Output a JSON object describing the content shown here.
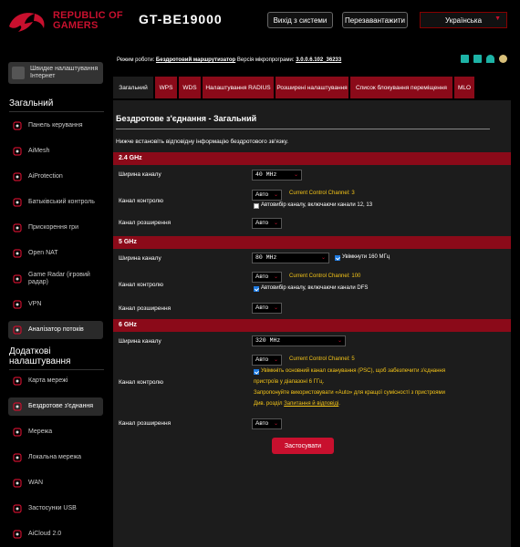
{
  "header": {
    "brand_line1": "REPUBLIC OF",
    "brand_line2": "GAMERS",
    "model": "GT-BE19000",
    "logout_label": "Вихід з системи",
    "reboot_label": "Перезавантажити",
    "language": "Українська"
  },
  "sidebar": {
    "quick_setup": "Швидке налаштування Інтернет",
    "general_title": "Загальний",
    "general_items": [
      {
        "label": "Панель керування",
        "icon": "dashboard-icon"
      },
      {
        "label": "AiMesh",
        "icon": "aimesh-icon"
      },
      {
        "label": "AiProtection",
        "icon": "aiprotection-icon"
      },
      {
        "label": "Батьківський контроль",
        "icon": "parental-control-icon"
      },
      {
        "label": "Прискорення гри",
        "icon": "game-boost-icon"
      },
      {
        "label": "Open NAT",
        "icon": "open-nat-icon"
      },
      {
        "label": "Game Radar (ігровий радар)",
        "icon": "game-radar-icon"
      },
      {
        "label": "VPN",
        "icon": "vpn-icon"
      },
      {
        "label": "Аналізатор потоків",
        "icon": "traffic-analyzer-icon"
      }
    ],
    "advanced_title": "Додаткові налаштування",
    "advanced_items": [
      {
        "label": "Карта мережі",
        "icon": "network-map-icon"
      },
      {
        "label": "Бездротове з'єднання",
        "icon": "wireless-icon"
      },
      {
        "label": "Мережа",
        "icon": "network-icon"
      },
      {
        "label": "Локальна мережа",
        "icon": "lan-icon"
      },
      {
        "label": "WAN",
        "icon": "wan-icon"
      },
      {
        "label": "Застосунки USB",
        "icon": "usb-icon"
      },
      {
        "label": "AiCloud 2.0",
        "icon": "aicloud-icon"
      }
    ]
  },
  "status": {
    "mode_label": "Режим роботи:",
    "mode_value": "Бездротовий маршрутизатор",
    "fw_label": "Версія мікропрограми:",
    "fw_value": "3.0.0.6.102_36233"
  },
  "tabs": [
    "Загальний",
    "WPS",
    "WDS",
    "Налаштування RADIUS",
    "Розширені налаштування",
    "Список блокування переміщення",
    "MLO"
  ],
  "page": {
    "title": "Бездротове з'єднання - Загальний",
    "description": "Нижче встановіть відповідну інформацію бездротового зв'язку."
  },
  "bands": {
    "b24": {
      "title": "2.4 GHz",
      "width_label": "Ширина каналу",
      "width_value": "40 MHz",
      "control_label": "Канал контролю",
      "control_value": "Авто",
      "current_channel": "Current Control Channel: 3",
      "auto_label": "Автовибір каналу, включаючи канали 12, 13",
      "ext_label": "Канал розширення",
      "ext_value": "Авто"
    },
    "b5": {
      "title": "5 GHz",
      "width_label": "Ширина каналу",
      "width_value": "80 MHz",
      "enable160_label": "Увімкнути 160 МГц",
      "control_label": "Канал контролю",
      "control_value": "Авто",
      "current_channel": "Current Control Channel: 100",
      "auto_label": "Автовибір каналу, включаючи канали DFS",
      "ext_label": "Канал розширення",
      "ext_value": "Авто"
    },
    "b6": {
      "title": "6 GHz",
      "width_label": "Ширина каналу",
      "width_value": "320 MHz",
      "control_label": "Канал контролю",
      "control_value": "Авто",
      "current_channel": "Current Control Channel: 5",
      "psc_label_1": "Увімкніть основний канал сканування (PSC), щоб забезпечити з'єднання",
      "psc_label_2": "пристроїв у діапазоні 6 ГГц.",
      "hint_1": "Запропонуйте використовувати «Auto» для кращої сумісності з пристроями",
      "hint_2_prefix": "Див. розділ",
      "hint_2_link": "Запитання й відповіді",
      "hint_2_suffix": ".",
      "ext_label": "Канал розширення",
      "ext_value": "Авто"
    }
  },
  "apply_label": "Застосувати",
  "colors": {
    "accent": "#c8102e",
    "band_bar": "#8b0a19",
    "panel": "#1c1c1c",
    "note": "#f5c518",
    "checkbox": "#1e7ae0"
  }
}
